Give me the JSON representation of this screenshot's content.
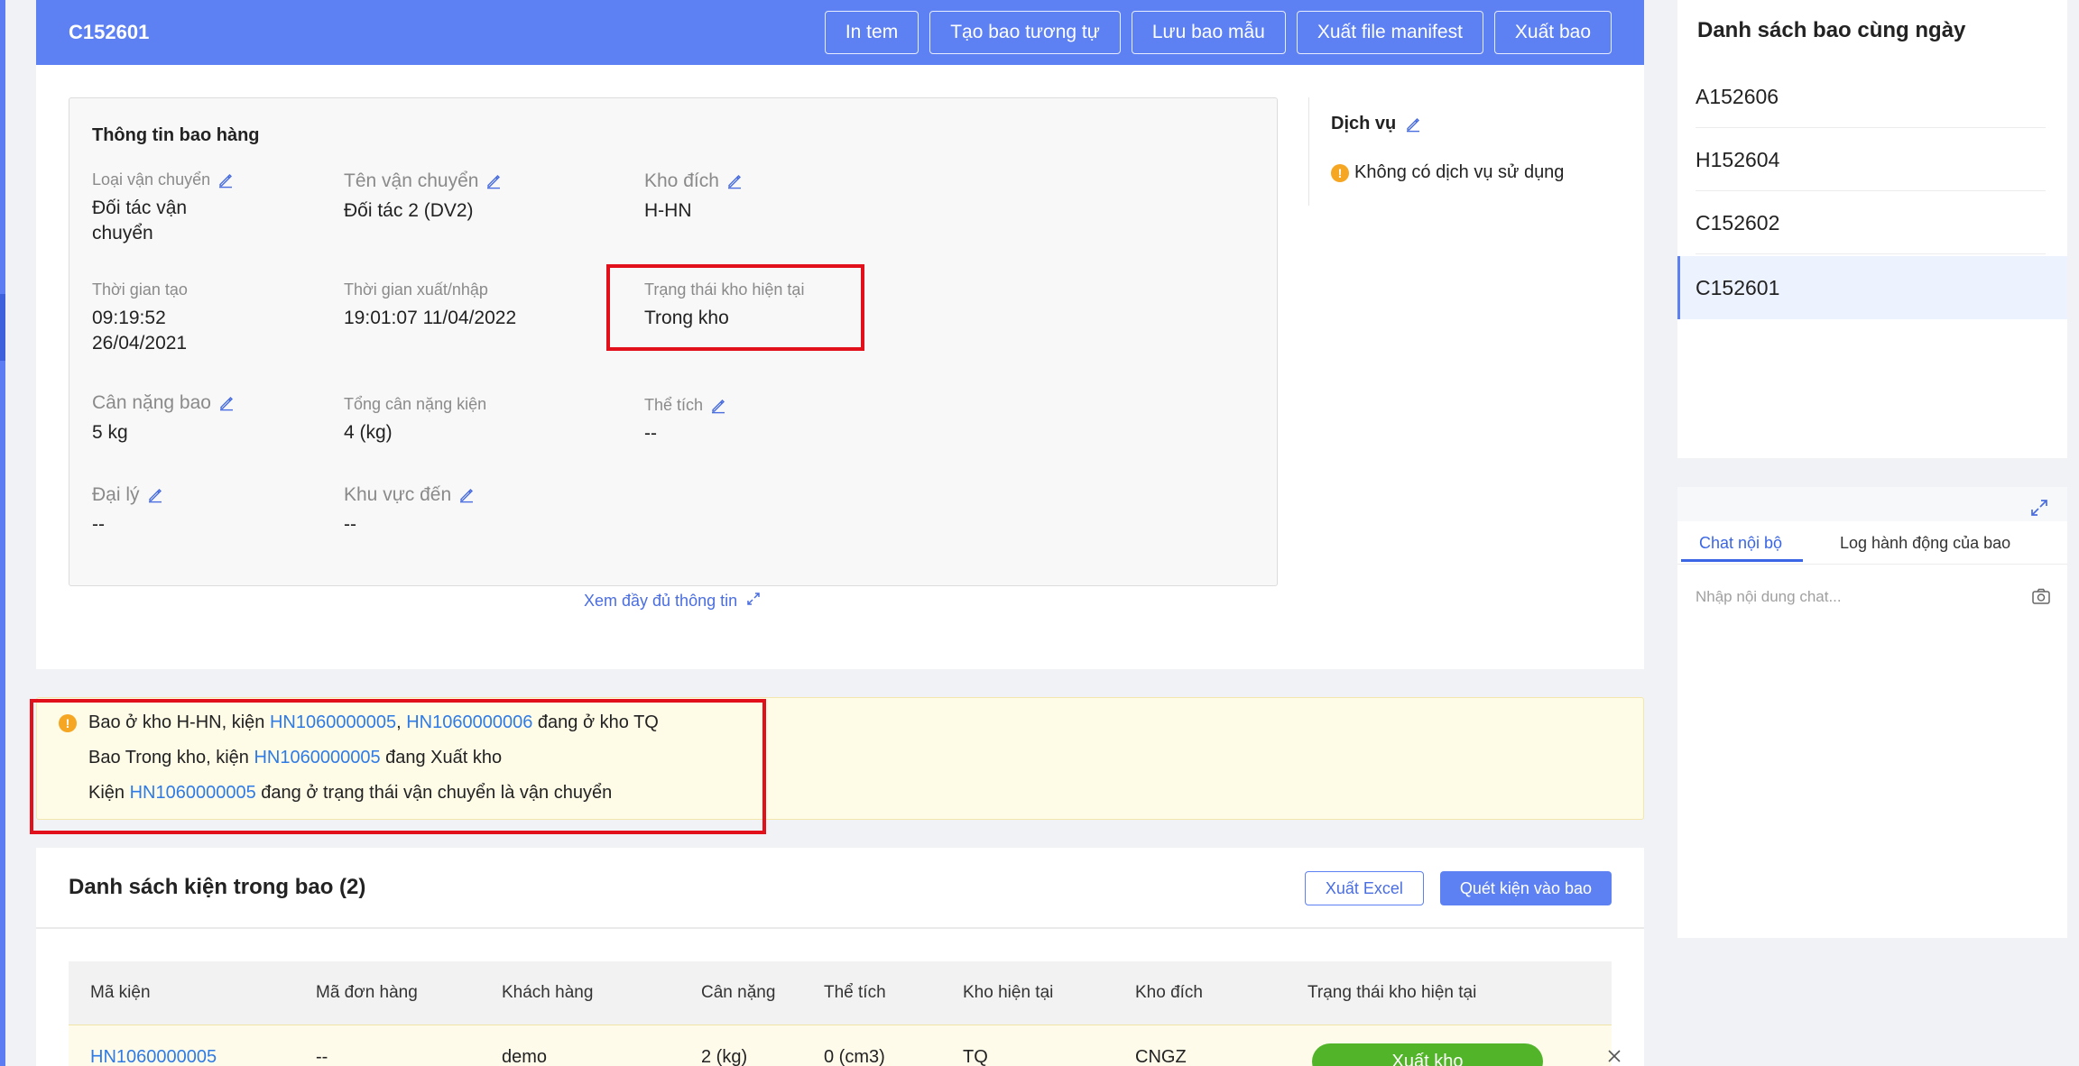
{
  "header": {
    "bag_code": "C152601",
    "actions": [
      "In tem",
      "Tạo bao tương tự",
      "Lưu bao mẫu",
      "Xuất file manifest",
      "Xuất bao"
    ]
  },
  "info": {
    "title": "Thông tin bao hàng",
    "shipping_type": {
      "label": "Loại vận chuyển",
      "value_line1": "Đối tác vận",
      "value_line2": "chuyển"
    },
    "carrier_name": {
      "label": "Tên vận chuyển",
      "value": "Đối tác 2 (DV2)"
    },
    "dest_warehouse": {
      "label": "Kho đích",
      "value": "H-HN"
    },
    "created_time": {
      "label": "Thời gian tạo",
      "value_line1": "09:19:52",
      "value_line2": "26/04/2021"
    },
    "io_time": {
      "label": "Thời gian xuất/nhập",
      "value": "19:01:07 11/04/2022"
    },
    "current_status": {
      "label": "Trạng thái kho hiện tại",
      "value": "Trong kho"
    },
    "bag_weight": {
      "label": "Cân nặng bao",
      "value": "5 kg"
    },
    "total_weight": {
      "label": "Tổng cân nặng kiện",
      "value": "4 (kg)"
    },
    "volume": {
      "label": "Thể tích",
      "value": "--"
    },
    "agent": {
      "label": "Đại lý",
      "value": "--"
    },
    "arrival_area": {
      "label": "Khu vực đến",
      "value": "--"
    },
    "see_more": "Xem đầy đủ thông tin"
  },
  "service": {
    "title": "Dịch vụ",
    "message": "Không có dịch vụ sử dụng"
  },
  "alert": {
    "line1": {
      "prefix": "Bao ở kho H-HN, kiện ",
      "link1": "HN1060000005",
      "sep": ", ",
      "link2": "HN1060000006",
      "suffix": " đang ở kho TQ"
    },
    "line2": {
      "prefix": "Bao Trong kho, kiện ",
      "link": "HN1060000005",
      "suffix": " đang Xuất kho"
    },
    "line3": {
      "prefix": "Kiện ",
      "link": "HN1060000005",
      "suffix": " đang ở trạng thái vận chuyển là vận chuyển"
    }
  },
  "package_list": {
    "title": "Danh sách kiện trong bao (2)",
    "export_excel": "Xuất Excel",
    "scan_button": "Quét kiện vào bao",
    "columns": [
      "Mã kiện",
      "Mã đơn hàng",
      "Khách hàng",
      "Cân nặng",
      "Thể tích",
      "Kho hiện tại",
      "Kho đích",
      "Trạng thái kho hiện tại"
    ],
    "rows": [
      {
        "code": "HN1060000005",
        "order": "--",
        "customer": "demo",
        "weight": "2 (kg)",
        "volume": "0 (cm3)",
        "current": "TQ",
        "dest": "CNGZ",
        "status": "Xuất kho"
      }
    ]
  },
  "same_day": {
    "title": "Danh sách bao cùng ngày",
    "items": [
      "A152606",
      "H152604",
      "C152602",
      "C152601"
    ],
    "active_index": 3
  },
  "chat": {
    "tabs": [
      "Chat nội bộ",
      "Log hành động của bao"
    ],
    "placeholder": "Nhập nội dung chat..."
  },
  "colors": {
    "primary": "#5d80f3",
    "highlight": "#e2101a",
    "warning": "#f5a623",
    "success": "#52b529",
    "link": "#2f7be5"
  }
}
